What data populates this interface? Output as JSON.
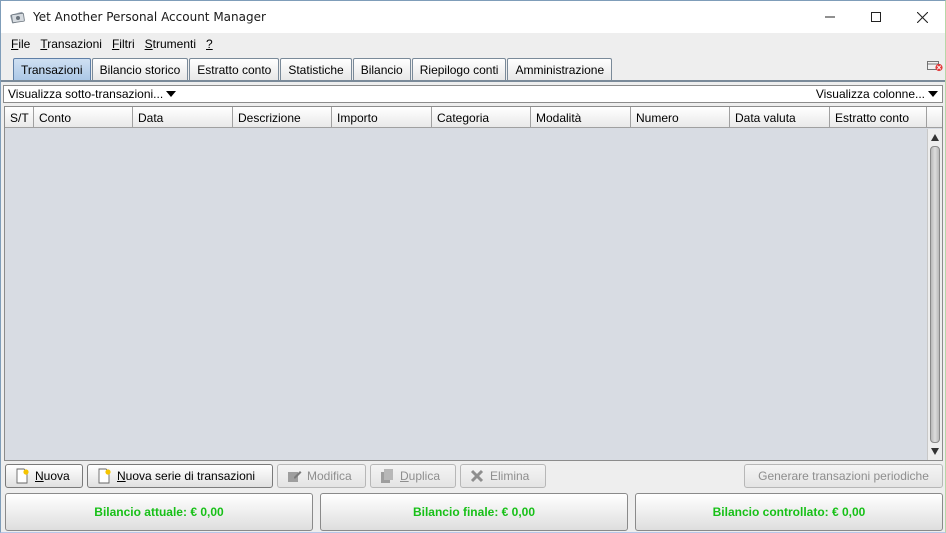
{
  "window": {
    "title": "Yet Another Personal Account Manager",
    "icon": "money-icon"
  },
  "menu": {
    "items": [
      {
        "mnemonic": "F",
        "rest": "ile"
      },
      {
        "mnemonic": "T",
        "rest": "ransazioni"
      },
      {
        "mnemonic": "F",
        "rest": "iltri"
      },
      {
        "mnemonic": "S",
        "rest": "trumenti"
      },
      {
        "mnemonic": "?",
        "rest": ""
      }
    ]
  },
  "tabs": {
    "items": [
      "Transazioni",
      "Bilancio storico",
      "Estratto conto",
      "Statistiche",
      "Bilancio",
      "Riepilogo conti",
      "Amministrazione"
    ],
    "active": "Transazioni"
  },
  "options": {
    "subtransactions": "Visualizza sotto-transazioni...",
    "columns": "Visualizza colonne..."
  },
  "table": {
    "columns": [
      "S/T",
      "Conto",
      "Data",
      "Descrizione",
      "Importo",
      "Categoria",
      "Modalità",
      "Numero",
      "Data valuta",
      "Estratto conto"
    ]
  },
  "actions": {
    "new": {
      "mnemonic": "N",
      "rest": "uova"
    },
    "new_series": {
      "mnemonic": "N",
      "rest": "uova serie di transazioni"
    },
    "edit": {
      "mnemonic": "",
      "rest": "Modifica"
    },
    "duplicate": {
      "mnemonic": "D",
      "rest": "uplica"
    },
    "delete": {
      "mnemonic": "",
      "rest": "Elimina"
    },
    "generate": "Generare transazioni periodiche"
  },
  "balances": {
    "current": "Bilancio attuale: € 0,00",
    "final": "Bilancio finale: € 0,00",
    "checked": "Bilancio controllato: € 0,00"
  },
  "colors": {
    "balance_text": "#17c017",
    "active_tab": "#aac6e6"
  }
}
